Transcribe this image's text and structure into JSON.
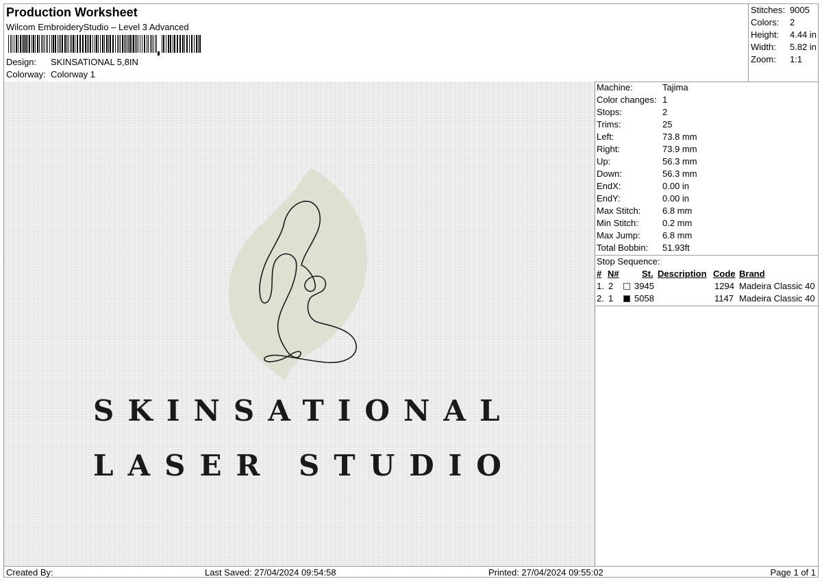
{
  "header": {
    "title": "Production Worksheet",
    "subtitle": "Wilcom EmbroideryStudio – Level 3 Advanced",
    "design_label": "Design:",
    "design_value": "SKINSATIONAL 5,8IN",
    "colorway_label": "Colorway:",
    "colorway_value": "Colorway 1"
  },
  "stats": {
    "stitches_label": "Stitches:",
    "stitches": "9005",
    "colors_label": "Colors:",
    "colors": "2",
    "height_label": "Height:",
    "height": "4.44 in",
    "width_label": "Width:",
    "width": "5.82 in",
    "zoom_label": "Zoom:",
    "zoom": "1:1"
  },
  "design": {
    "line1": "SKINSATIONAL",
    "line2": "LASER STUDIO",
    "leaf_color": "#dfe3d4",
    "thread_color": "#1a1a1a"
  },
  "machine": {
    "machine_label": "Machine:",
    "machine": "Tajima",
    "color_changes_label": "Color changes:",
    "color_changes": "1",
    "stops_label": "Stops:",
    "stops": "2",
    "trims_label": "Trims:",
    "trims": "25",
    "left_label": "Left:",
    "left": "73.8 mm",
    "right_label": "Right:",
    "right": "73.9 mm",
    "up_label": "Up:",
    "up": "56.3 mm",
    "down_label": "Down:",
    "down": "56.3 mm",
    "endx_label": "EndX:",
    "endx": "0.00 in",
    "endy_label": "EndY:",
    "endy": "0.00 in",
    "max_stitch_label": "Max Stitch:",
    "max_stitch": "6.8 mm",
    "min_stitch_label": "Min Stitch:",
    "min_stitch": "0.2 mm",
    "max_jump_label": "Max Jump:",
    "max_jump": "6.8 mm",
    "total_bobbin_label": "Total Bobbin:",
    "total_bobbin": "51.93ft"
  },
  "stop_sequence": {
    "heading": "Stop Sequence:",
    "columns": [
      "#",
      "N#",
      "St.",
      "Description",
      "Code",
      "Brand"
    ],
    "rows": [
      {
        "num": "1.",
        "n": "2",
        "swatch": "#ffffff",
        "st": "3945",
        "desc": "",
        "code": "1294",
        "brand": "Madeira Classic 40"
      },
      {
        "num": "2.",
        "n": "1",
        "swatch": "#000000",
        "st": "5058",
        "desc": "",
        "code": "1147",
        "brand": "Madeira Classic 40"
      }
    ]
  },
  "footer": {
    "created_by": "Created By:",
    "last_saved": "Last Saved: 27/04/2024 09:54:58",
    "printed": "Printed: 27/04/2024 09:55:02",
    "page": "Page 1 of 1"
  }
}
